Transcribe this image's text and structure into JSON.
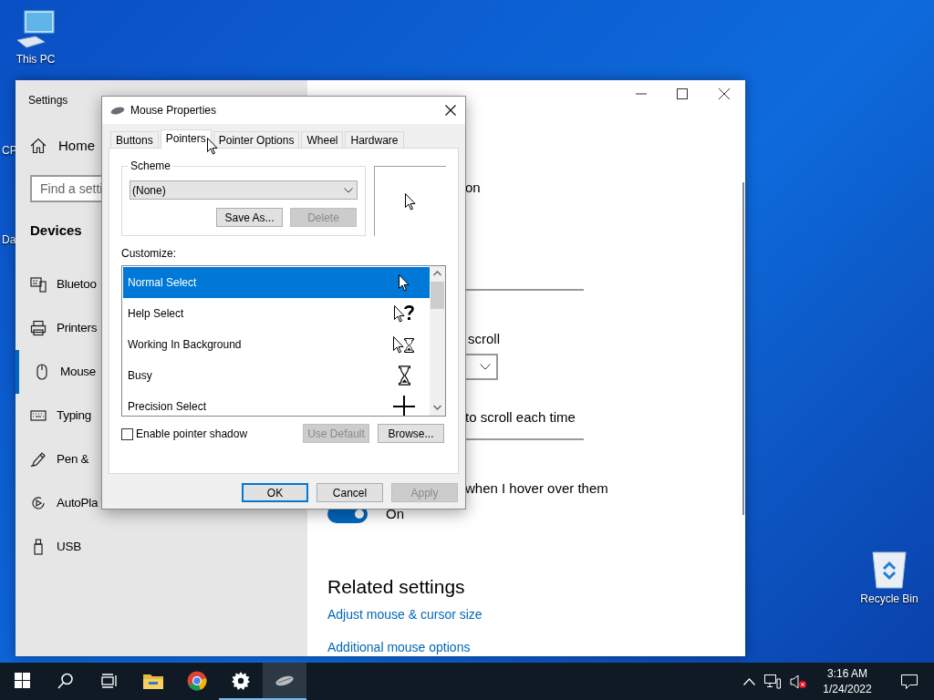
{
  "desktop_icons": [
    {
      "kind": "pc",
      "label": "This PC"
    },
    {
      "kind": "recycle",
      "label": "Recycle Bin"
    }
  ],
  "peeking_labels": [
    "CP",
    "Da"
  ],
  "settings": {
    "title": "Settings",
    "home": "Home",
    "search": {
      "placeholder": "Find a setti"
    },
    "section": "Devices",
    "sidebar_items": [
      {
        "kind": "bluetooth",
        "label": "Bluetoo",
        "selected": false
      },
      {
        "kind": "printer",
        "label": "Printers",
        "selected": false
      },
      {
        "kind": "mouse",
        "label": "Mouse",
        "selected": true
      },
      {
        "kind": "keyboard",
        "label": "Typing",
        "selected": false
      },
      {
        "kind": "pen",
        "label": "Pen &",
        "selected": false
      },
      {
        "kind": "autoplay",
        "label": "AutoPla",
        "selected": false
      },
      {
        "kind": "usb",
        "label": "USB",
        "selected": false
      }
    ],
    "content": {
      "text_1": "on",
      "text_2": "scroll",
      "text_3": "to scroll each time",
      "text_4": "when I hover over them",
      "toggle": {
        "on": true,
        "label": "On"
      },
      "related_heading": "Related settings",
      "links": [
        "Adjust mouse & cursor size",
        "Additional mouse options"
      ]
    }
  },
  "dialog": {
    "title": "Mouse Properties",
    "tabs": [
      {
        "label": "Buttons",
        "selected": false
      },
      {
        "label": "Pointers",
        "selected": true
      },
      {
        "label": "Pointer Options",
        "selected": false
      },
      {
        "label": "Wheel",
        "selected": false
      },
      {
        "label": "Hardware",
        "selected": false
      }
    ],
    "scheme": {
      "legend": "Scheme",
      "value": "(None)",
      "buttons": [
        {
          "label": "Save As...",
          "disabled": false
        },
        {
          "label": "Delete",
          "disabled": true
        }
      ]
    },
    "customize_label": "Customize:",
    "pointers": [
      {
        "label": "Normal Select",
        "kind": "arrow",
        "selected": true
      },
      {
        "label": "Help Select",
        "kind": "help",
        "selected": false
      },
      {
        "label": "Working In Background",
        "kind": "working",
        "selected": false
      },
      {
        "label": "Busy",
        "kind": "busy",
        "selected": false
      },
      {
        "label": "Precision Select",
        "kind": "cross",
        "selected": false
      }
    ],
    "shadow": {
      "label": "Enable pointer shadow",
      "checked": false
    },
    "list_buttons": [
      {
        "label": "Use Default",
        "disabled": true
      },
      {
        "label": "Browse...",
        "disabled": false
      }
    ],
    "footer_buttons": [
      {
        "label": "OK",
        "disabled": false,
        "default": true
      },
      {
        "label": "Cancel",
        "disabled": false,
        "default": false
      },
      {
        "label": "Apply",
        "disabled": true,
        "default": false
      }
    ]
  },
  "taskbar": {
    "apps": [
      {
        "kind": "start",
        "active": false
      },
      {
        "kind": "search",
        "active": false
      },
      {
        "kind": "taskview",
        "active": false
      },
      {
        "kind": "explorer",
        "active": false
      },
      {
        "kind": "chrome",
        "active": false
      },
      {
        "kind": "settings",
        "active": true
      },
      {
        "kind": "mouse",
        "active": true
      }
    ],
    "time": "3:16 AM",
    "date": "1/24/2022"
  }
}
